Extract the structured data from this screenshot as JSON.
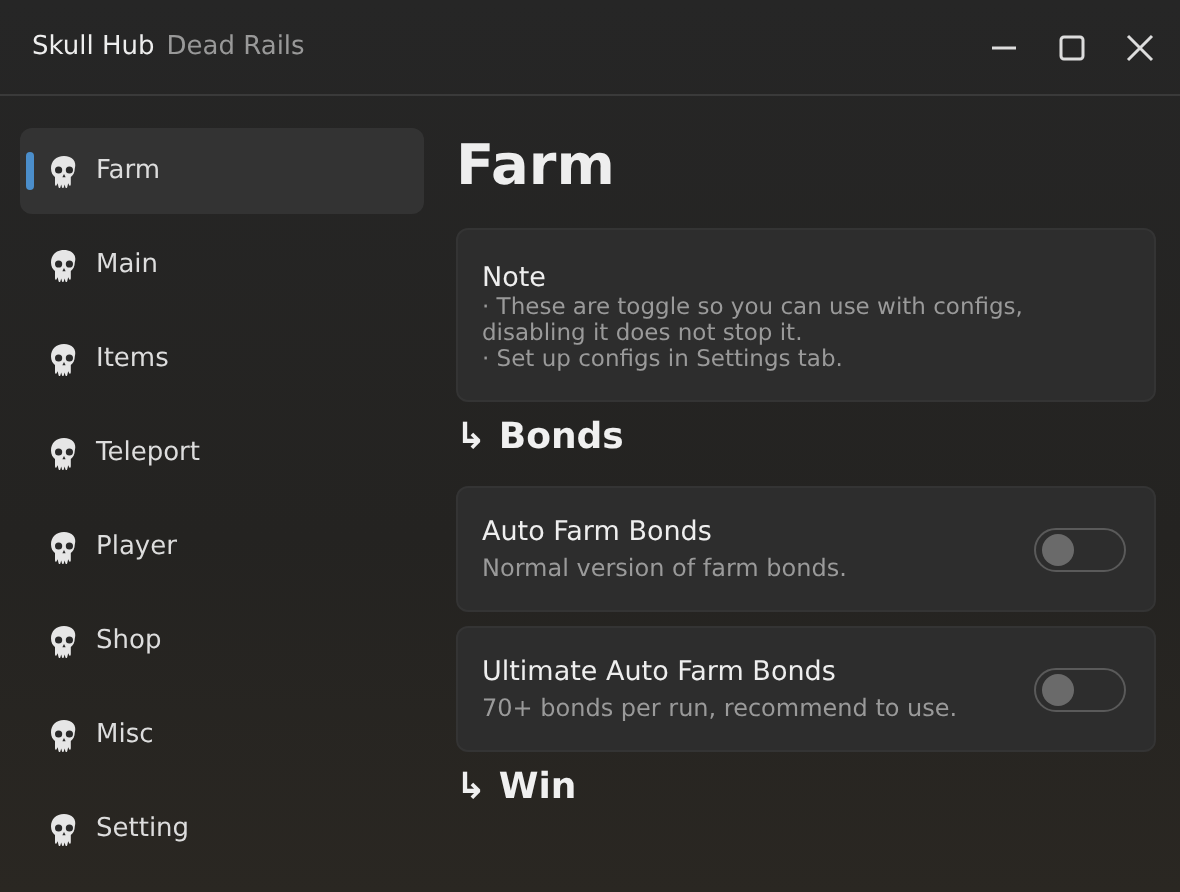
{
  "window": {
    "title": "Skull Hub",
    "subtitle": "Dead Rails"
  },
  "sidebar": {
    "items": [
      {
        "label": "Farm",
        "selected": true
      },
      {
        "label": "Main",
        "selected": false
      },
      {
        "label": "Items",
        "selected": false
      },
      {
        "label": "Teleport",
        "selected": false
      },
      {
        "label": "Player",
        "selected": false
      },
      {
        "label": "Shop",
        "selected": false
      },
      {
        "label": "Misc",
        "selected": false
      },
      {
        "label": "Setting",
        "selected": false
      }
    ]
  },
  "page": {
    "title": "Farm",
    "sections": [
      {
        "kind": "note",
        "title": "Note",
        "lines": [
          "· These are toggle so you can use with configs, disabling it does not stop it.",
          "· Set up configs in Settings tab."
        ]
      },
      {
        "kind": "heading",
        "arrow": "↳",
        "title": "Bonds"
      },
      {
        "kind": "toggle",
        "title": "Auto Farm Bonds",
        "description": "Normal version of farm bonds.",
        "on": false
      },
      {
        "kind": "toggle",
        "title": "Ultimate Auto Farm Bonds",
        "description": "70+ bonds per run, recommend to use.",
        "on": false
      },
      {
        "kind": "heading",
        "arrow": "↳",
        "title": "Win"
      }
    ]
  }
}
